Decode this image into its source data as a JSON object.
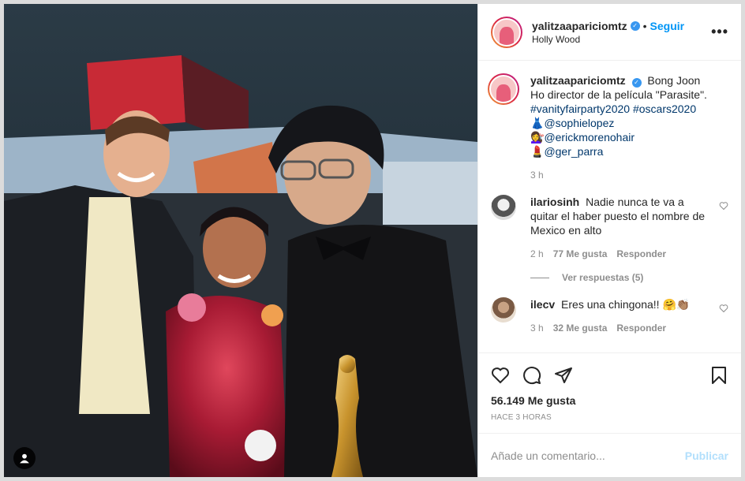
{
  "post": {
    "username": "yalitzaapariciomtz",
    "follow_label": "Seguir",
    "separator": "•",
    "location": "Holly Wood",
    "more_label": "•••"
  },
  "caption": {
    "username": "yalitzaapariciomtz",
    "text": "Bong Joon Ho director de la película \"Parasite\".",
    "hashtags": "#vanityfairparty2020 #oscars2020",
    "credits": [
      {
        "emoji": "👗",
        "handle": "@sophielopez"
      },
      {
        "emoji": "💇‍♀️",
        "handle": "@erickmorenohair"
      },
      {
        "emoji": "💄",
        "handle": "@ger_parra"
      }
    ],
    "time": "3 h"
  },
  "comments": [
    {
      "username": "ilariosinh",
      "text": "Nadie nunca te va a quitar el haber puesto el nombre de Mexico en alto",
      "time": "2 h",
      "likes": "77 Me gusta",
      "reply": "Responder",
      "view_replies": "Ver respuestas (5)"
    },
    {
      "username": "ilecv",
      "text": "Eres una chingona!! 🤗👏🏽",
      "time": "3 h",
      "likes": "32 Me gusta",
      "reply": "Responder"
    }
  ],
  "stats": {
    "likes": "56.149 Me gusta",
    "time": "Hace 3 horas"
  },
  "add_comment": {
    "placeholder": "Añade un comentario...",
    "publish": "Publicar"
  },
  "colors": {
    "accent": "#0095f6",
    "verified": "#3897f0",
    "tag": "#00376b"
  }
}
